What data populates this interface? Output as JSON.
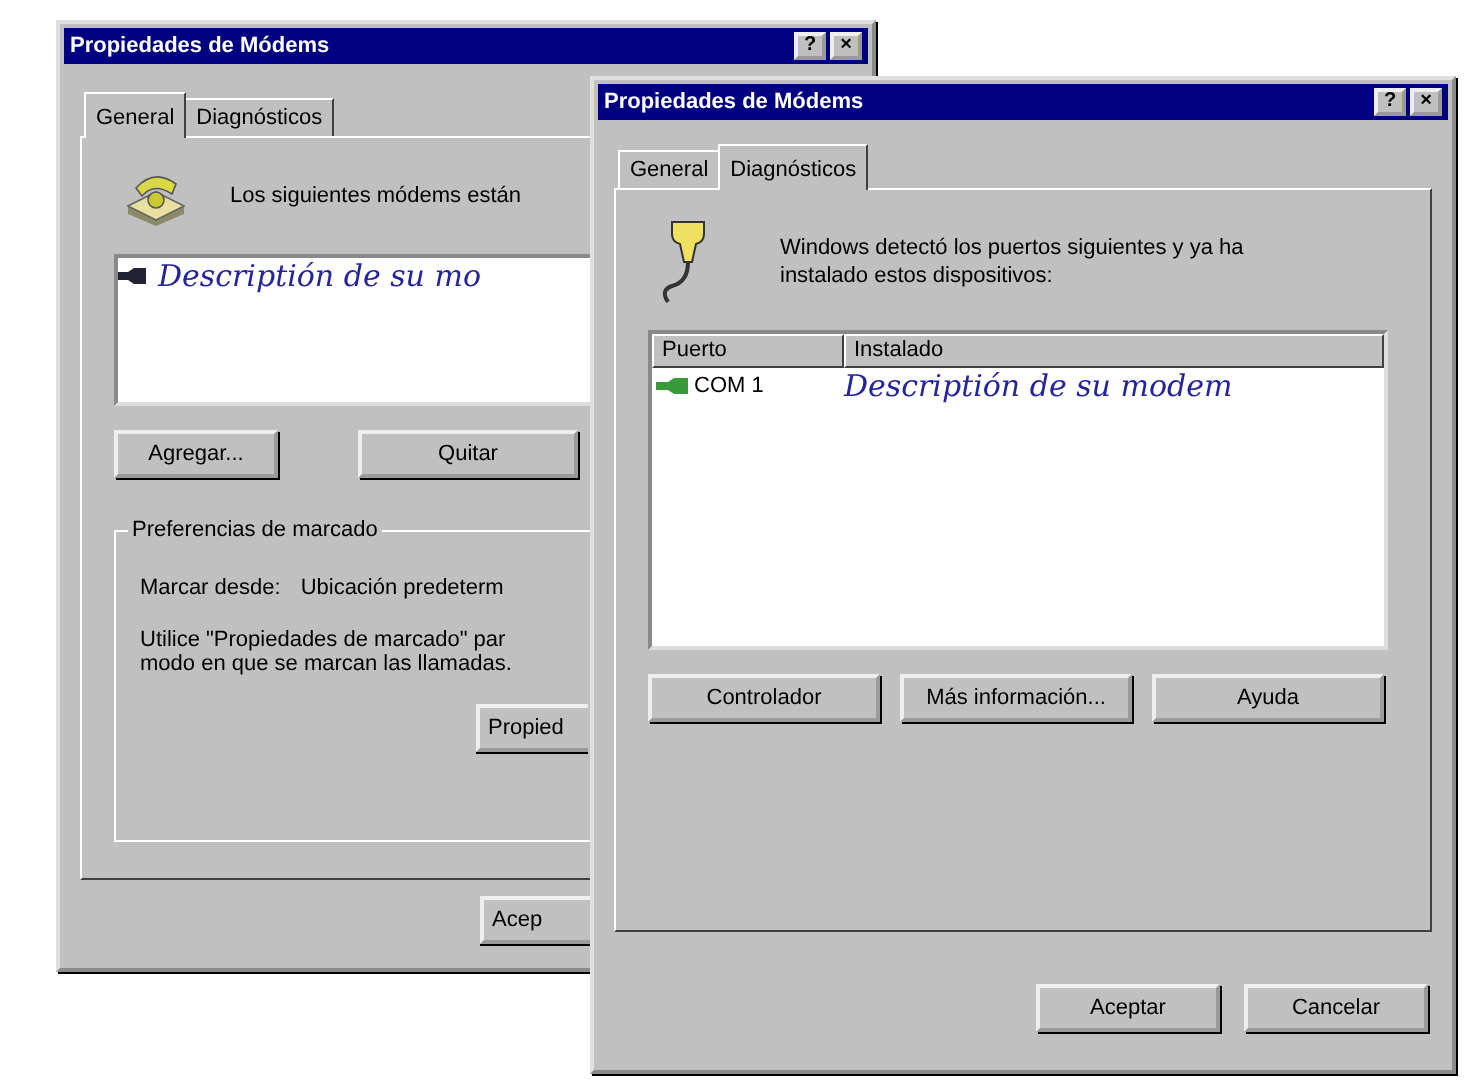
{
  "back_window": {
    "title": "Propiedades de Módems",
    "title_buttons": [
      "?",
      "×"
    ],
    "tabs": [
      {
        "label": "General",
        "selected": true
      },
      {
        "label": "Diagnósticos",
        "selected": false
      }
    ],
    "intro_text": "Los siguientes módems están",
    "modem_list": [
      {
        "name": "Descriptión de su mo",
        "selected": false
      }
    ],
    "buttons": [
      "Agregar...",
      "Quitar"
    ],
    "group": {
      "title": "Preferencias de marcado",
      "dial_from_label": "Marcar desde:",
      "dial_from_value": "Ubicación predeterm",
      "note_lines": [
        "Utilice \"Propiedades de marcado\" par",
        "modo en que se marcan las llamadas."
      ],
      "button": "Propied"
    },
    "footer_buttons": [
      "Acep"
    ]
  },
  "front_window": {
    "title": "Propiedades de Módems",
    "title_buttons": [
      "?",
      "×"
    ],
    "tabs": [
      {
        "label": "General",
        "selected": false
      },
      {
        "label": "Diagnósticos",
        "selected": true
      }
    ],
    "intro_text": "Windows detectó los puertos siguientes y ya ha instalado estos dispositivos:",
    "port_list": {
      "columns": [
        "Puerto",
        "Instalado"
      ],
      "rows": [
        {
          "port": "COM 1",
          "installed": "Descriptión de su modem",
          "selected": false
        }
      ]
    },
    "buttons": [
      "Controlador",
      "Más información...",
      "Ayuda"
    ],
    "footer_buttons": [
      "Aceptar",
      "Cancelar"
    ]
  }
}
